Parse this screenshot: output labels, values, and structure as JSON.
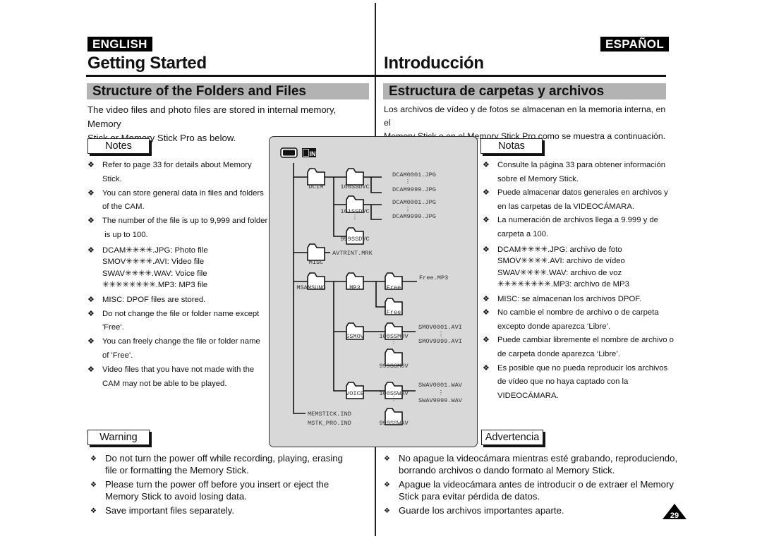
{
  "english": {
    "lang_label": "ENGLISH",
    "page_title": "Getting Started",
    "section_title": "Structure of the Folders and Files",
    "intro_lines": [
      "The video files and photo files are stored in internal memory, Memory",
      "Stick or Memory Stick Pro as below."
    ],
    "notes_label": "Notes",
    "notes": [
      {
        "lines": [
          "Refer to page 33 for details about Memory Stick."
        ]
      },
      {
        "lines": [
          "You can store general data in files and folders",
          "of the CAM."
        ]
      },
      {
        "lines": [
          "The number of the file is up to 9,999 and folder",
          " is up to 100."
        ]
      },
      {
        "lines": [
          "DCAM✳✳✳✳.JPG: Photo file",
          "SMOV✳✳✳✳.AVI: Video file",
          "SWAV✳✳✳✳.WAV: Voice file",
          "✳✳✳✳✳✳✳✳.MP3: MP3 file"
        ]
      },
      {
        "lines": [
          "MISC: DPOF files are stored."
        ]
      },
      {
        "lines": [
          "Do not change the file or folder name except",
          "'Free'."
        ]
      },
      {
        "lines": [
          "You can freely change the file or folder name",
          "of 'Free'."
        ]
      },
      {
        "lines": [
          "Video files that you have not made with the",
          "CAM may not be able to be played."
        ]
      }
    ],
    "warning_label": "Warning",
    "warnings": [
      {
        "lines": [
          "Do not turn the power off while recording, playing, erasing",
          "file or formatting the Memory Stick."
        ]
      },
      {
        "lines": [
          "Please turn the power off before you insert or eject the",
          "Memory Stick to avoid losing data."
        ]
      },
      {
        "lines": [
          "Save important files separately."
        ]
      }
    ]
  },
  "spanish": {
    "lang_label": "ESPAÑOL",
    "page_title": "Introducción",
    "section_title": "Estructura de carpetas y archivos",
    "intro_lines": [
      "Los archivos de vídeo y de fotos se almacenan en la memoria interna, en el",
      "Memory Stick o en el Memory Stick Pro como se muestra a continuación."
    ],
    "notes_label": "Notas",
    "notes": [
      {
        "lines": [
          "Consulte la página 33 para obtener información",
          "sobre el Memory Stick."
        ]
      },
      {
        "lines": [
          "Puede almacenar datos generales en archivos y",
          "en las carpetas de la VIDEOCÁMARA."
        ]
      },
      {
        "lines": [
          "La numeración de archivos llega a 9.999 y de",
          "carpeta a 100."
        ]
      },
      {
        "lines": [
          "DCAM✳✳✳✳.JPG: archivo de foto",
          "SMOV✳✳✳✳.AVI: archivo de vídeo",
          "SWAV✳✳✳✳.WAV: archivo de voz",
          "✳✳✳✳✳✳✳✳.MP3: archivo de MP3"
        ]
      },
      {
        "lines": [
          "MISC: se almacenan los archivos DPOF."
        ]
      },
      {
        "lines": [
          "No cambie el nombre de archivo o de carpeta",
          "excepto donde aparezca ‘Libre’."
        ]
      },
      {
        "lines": [
          "Puede cambiar libremente el nombre de archivo o",
          "de carpeta donde aparezca ‘Libre’."
        ]
      },
      {
        "lines": [
          "Es posible que no pueda reproducir los archivos",
          "de vídeo que no haya captado con la",
          "VIDEOCÁMARA."
        ]
      }
    ],
    "warning_label": "Advertencia",
    "warnings": [
      {
        "lines": [
          "No apague la videocámara mientras esté grabando, reproduciendo,",
          "borrando archivos o dando formato al Memory Stick."
        ]
      },
      {
        "lines": [
          "Apague la videocámara antes de introducir o de extraer el Memory",
          "Stick para evitar pérdida de datos."
        ]
      },
      {
        "lines": [
          "Guarde los archivos importantes aparte."
        ]
      }
    ]
  },
  "bullet_glyph": "❖",
  "diagram": {
    "icons": [
      "memory-stick-icon",
      "internal-memory-icon"
    ],
    "internal_memory_label": "IN",
    "folders": {
      "dcim": "DCIM",
      "ssdvc_100": "100SSDVC",
      "ssdvc_101": "101SSDVC",
      "ssdvc_999": "999SSDVC",
      "misc": "MISC",
      "msamsung": "MSAMSUNG",
      "mp3": "MP3",
      "free1": "Free",
      "free2": "Free",
      "ssmov": "SSMOV",
      "ssmov_100": "100SSMOV",
      "ssmov_999": "999SSMOV",
      "voice": "VOICE",
      "sswav_100": "100SSWAV",
      "sswav_999": "999SSWAV"
    },
    "files": {
      "dcam_first_a": "DCAM0001.JPG",
      "dcam_last_a": "DCAM9999.JPG",
      "dcam_first_b": "DCAM0001.JPG",
      "dcam_last_b": "DCAM9999.JPG",
      "avtrint": "AVTRINT.MRK",
      "free_mp3": "Free.MP3",
      "smov_first": "SMOV0001.AVI",
      "smov_last": "SMOV9999.AVI",
      "swav_first": "SWAV0001.WAV",
      "swav_last": "SWAV9999.WAV",
      "memstick": "MEMSTICK.IND",
      "mstk_pro": "MSTK_PRO.IND"
    },
    "ellipsis": "⋮"
  },
  "page_number": "29"
}
